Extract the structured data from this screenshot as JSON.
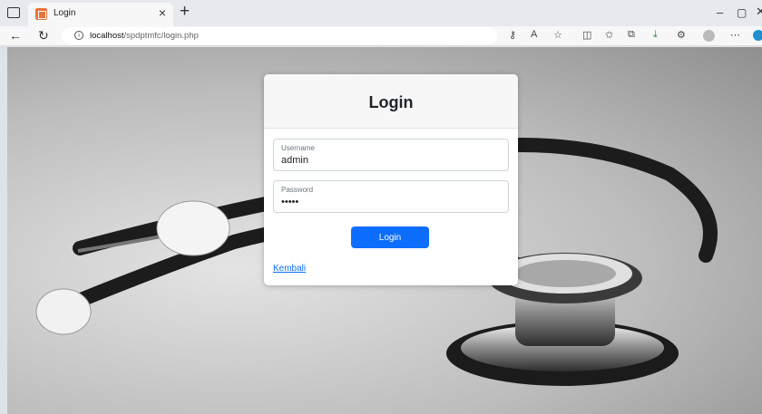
{
  "browser": {
    "tab_title": "Login",
    "tab_close": "×",
    "new_tab": "+",
    "url_host": "localhost",
    "url_path": "/spdptmfc/login.php",
    "window_controls": {
      "minimize": "–",
      "maximize": "▢",
      "close": "✕"
    }
  },
  "login": {
    "title": "Login",
    "username": {
      "label": "Username",
      "value": "admin"
    },
    "password": {
      "label": "Password",
      "value": "•••••"
    },
    "submit_label": "Login",
    "back_link": "Kembali"
  },
  "colors": {
    "primary": "#0d6efd",
    "card_header": "#f7f7f7",
    "favicon": "#e8743b"
  }
}
